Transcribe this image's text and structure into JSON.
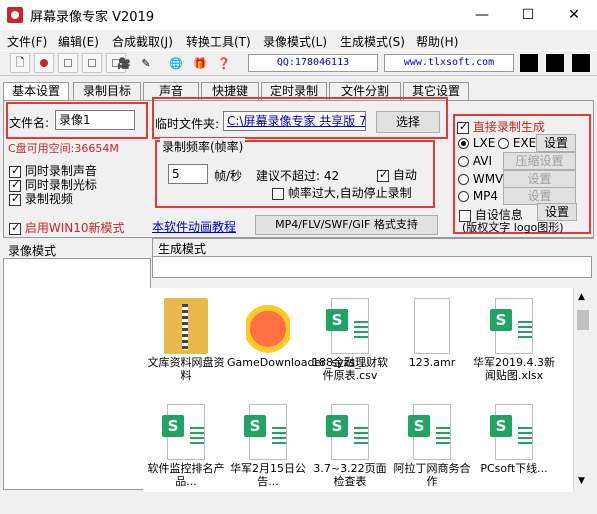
{
  "window": {
    "title": "屏幕录像专家 V2019",
    "minimize": "—",
    "maximize": "☐",
    "close": "✕"
  },
  "menu": [
    "文件(F)",
    "编辑(E)",
    "合成截取(J)",
    "转换工具(T)",
    "录像模式(L)",
    "生成模式(S)",
    "帮助(H)"
  ],
  "toolbar": {
    "qq": "QQ:178046113",
    "website": "www.tlxsoft.com"
  },
  "tabs": [
    "基本设置",
    "录制目标",
    "声音",
    "快捷键",
    "定时录制",
    "文件分割",
    "其它设置"
  ],
  "basic": {
    "filename_label": "文件名:",
    "filename_value": "录像1",
    "disk_space": "C盘可用空间:36654M",
    "chk_audio": "同时录制声音",
    "chk_cursor": "同时录制光标",
    "chk_video": "录制视频",
    "chk_win10": "启用WIN10新模式",
    "temp_label": "临时文件夹:",
    "temp_value": "C:\\屏幕录像专家 共享版 7",
    "browse": "选择",
    "freq_group": "录制频率(帧率)",
    "fps_value": "5",
    "fps_unit": "帧/秒",
    "suggest": "建议不超过: 42",
    "auto": "自动",
    "auto_stop": "帧率过大,自动停止录制",
    "tutorial_link": "本软件动画教程",
    "format_btn": "MP4/FLV/SWF/GIF  格式支持"
  },
  "output": {
    "direct": "直接录制生成",
    "lxe": "LXE",
    "exe": "EXE",
    "set": "设置",
    "avi": "AVI",
    "compress": "压缩设置",
    "wmv": "WMV",
    "mp4": "MP4",
    "custom_info": "自设信息",
    "custom_set": "设置",
    "copyright": "(版权文字 logo图形)"
  },
  "panes": {
    "record_mode": "录像模式",
    "gen_mode": "生成模式"
  },
  "files": [
    {
      "name": "文库资料网盘资料",
      "type": "folder"
    },
    {
      "name": "GameDownloader_syzs_...",
      "type": "game"
    },
    {
      "name": "188金融理财软件原表.csv",
      "type": "sheet"
    },
    {
      "name": "123.amr",
      "type": "blank"
    },
    {
      "name": "华军2019.4.3新闻贴图.xlsx",
      "type": "sheet"
    },
    {
      "name": "软件监控排名产品...",
      "type": "sheet"
    },
    {
      "name": "华军2月15日公告...",
      "type": "sheet"
    },
    {
      "name": "3.7~3.22页面检查表",
      "type": "sheet"
    },
    {
      "name": "阿拉丁网商务合作",
      "type": "sheet"
    },
    {
      "name": "PCsoft下线...",
      "type": "sheet"
    }
  ],
  "colors": {
    "highlight_box": "#e53935",
    "link": "#0000cc",
    "excel_green": "#21a366"
  }
}
